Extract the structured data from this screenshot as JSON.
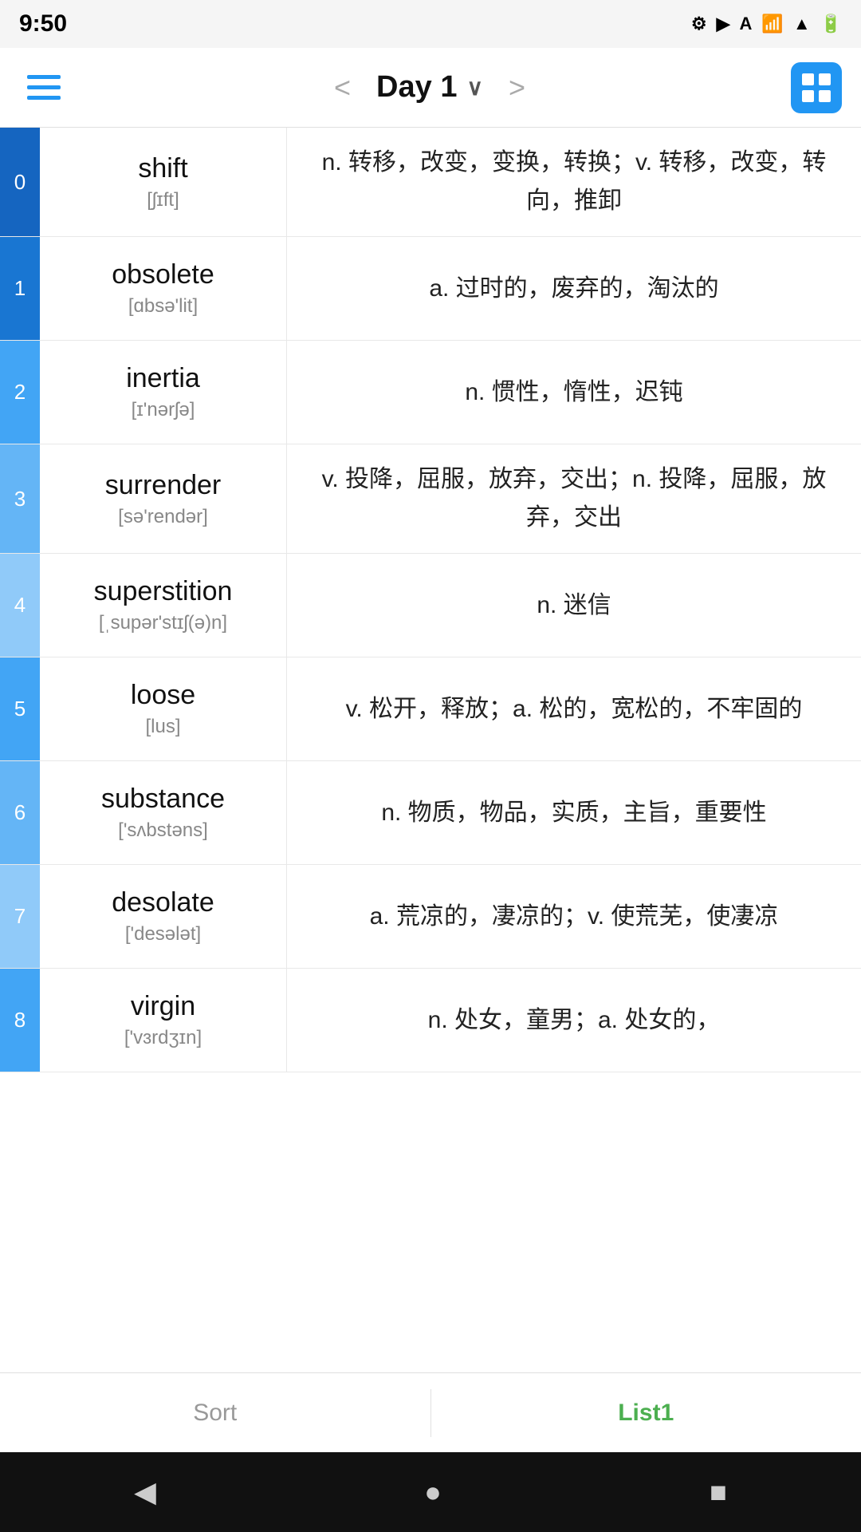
{
  "statusBar": {
    "time": "9:50",
    "icons": [
      "settings",
      "play",
      "text",
      "wifi",
      "dot",
      "signal",
      "battery"
    ]
  },
  "navBar": {
    "title": "Day 1",
    "prevArrow": "<",
    "nextArrow": ">",
    "menuIcon": "hamburger"
  },
  "words": [
    {
      "index": "0",
      "english": "shift",
      "phonetic": "[ʃɪft]",
      "definition": "n. 转移，改变，变换，转换；v. 转移，改变，转向，推卸",
      "colorClass": "blue-dark"
    },
    {
      "index": "1",
      "english": "obsolete",
      "phonetic": "[ɑbsə'lit]",
      "definition": "a. 过时的，废弃的，淘汰的",
      "colorClass": "blue-mid"
    },
    {
      "index": "2",
      "english": "inertia",
      "phonetic": "[ɪ'nərʃə]",
      "definition": "n. 惯性，惰性，迟钝",
      "colorClass": "blue-light"
    },
    {
      "index": "3",
      "english": "surrender",
      "phonetic": "[sə'rendər]",
      "definition": "v. 投降，屈服，放弃，交出；n. 投降，屈服，放弃，交出",
      "colorClass": "blue-lighter"
    },
    {
      "index": "4",
      "english": "superstition",
      "phonetic": "[ˌsupər'stɪʃ(ə)n]",
      "definition": "n. 迷信",
      "colorClass": "blue-lightest"
    },
    {
      "index": "5",
      "english": "loose",
      "phonetic": "[lus]",
      "definition": "v. 松开，释放；a. 松的，宽松的，不牢固的",
      "colorClass": "blue-light"
    },
    {
      "index": "6",
      "english": "substance",
      "phonetic": "['sʌbstəns]",
      "definition": "n. 物质，物品，实质，主旨，重要性",
      "colorClass": "blue-lighter"
    },
    {
      "index": "7",
      "english": "desolate",
      "phonetic": "['desələt]",
      "definition": "a. 荒凉的，凄凉的；v. 使荒芜，使凄凉",
      "colorClass": "blue-lightest"
    },
    {
      "index": "8",
      "english": "virgin",
      "phonetic": "['vɜrdʒɪn]",
      "definition": "n. 处女，童男；a. 处女的，",
      "colorClass": "blue-light"
    }
  ],
  "bottomTabs": [
    {
      "label": "Sort",
      "active": false
    },
    {
      "label": "List1",
      "active": true
    }
  ],
  "androidNav": {
    "backLabel": "◀",
    "homeLabel": "●",
    "recentLabel": "■"
  }
}
